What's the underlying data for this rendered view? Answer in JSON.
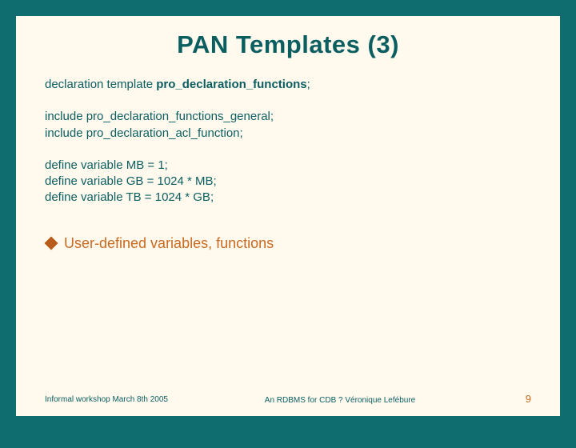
{
  "title": "PAN Templates (3)",
  "code": {
    "decl_prefix": "declaration template ",
    "decl_name": "pro_declaration_functions",
    "decl_suffix": ";",
    "include1": "include pro_declaration_functions_general;",
    "include2": "include pro_declaration_acl_function;",
    "def1": "define variable MB = 1;",
    "def2": "define variable GB = 1024 * MB;",
    "def3": "define variable TB = 1024 * GB;"
  },
  "bullet": "User-defined variables, functions",
  "footer": {
    "left": "Informal workshop March 8th 2005",
    "center": "An RDBMS for CDB ? Véronique Lefébure",
    "page": "9"
  }
}
